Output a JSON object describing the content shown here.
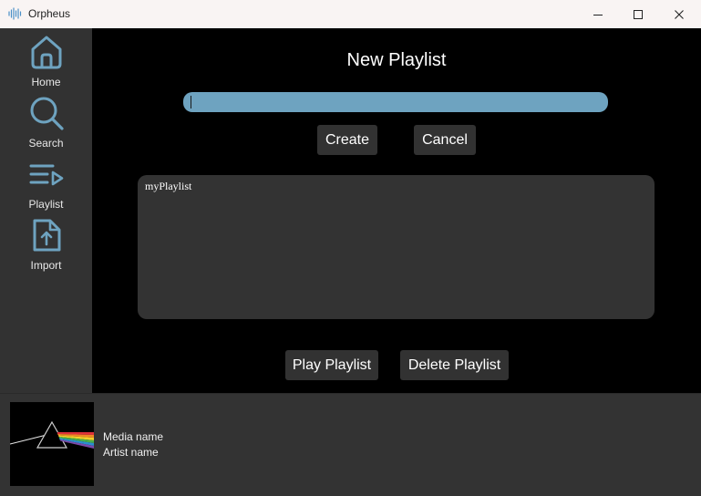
{
  "window": {
    "title": "Orpheus",
    "controls": [
      "minimize-icon",
      "maximize-icon",
      "close-icon"
    ]
  },
  "sidebar": {
    "items": [
      {
        "label": "Home",
        "icon": "home-icon"
      },
      {
        "label": "Search",
        "icon": "search-icon"
      },
      {
        "label": "Playlist",
        "icon": "playlist-icon"
      },
      {
        "label": "Import",
        "icon": "import-file-icon"
      }
    ]
  },
  "main": {
    "heading": "New Playlist",
    "name_input": {
      "value": "",
      "placeholder": ""
    },
    "create_label": "Create",
    "cancel_label": "Cancel",
    "playlists": [
      "myPlaylist"
    ],
    "play_label": "Play Playlist",
    "delete_label": "Delete Playlist"
  },
  "player": {
    "media_name": "Media name",
    "artist_name": "Artist name",
    "album_art": "prism-album-art"
  },
  "colors": {
    "accent": "#6ea3c0",
    "sidebar_bg": "#323232",
    "main_bg": "#000000",
    "button_bg": "#323232",
    "titlebar_bg": "#f9f4f3"
  }
}
